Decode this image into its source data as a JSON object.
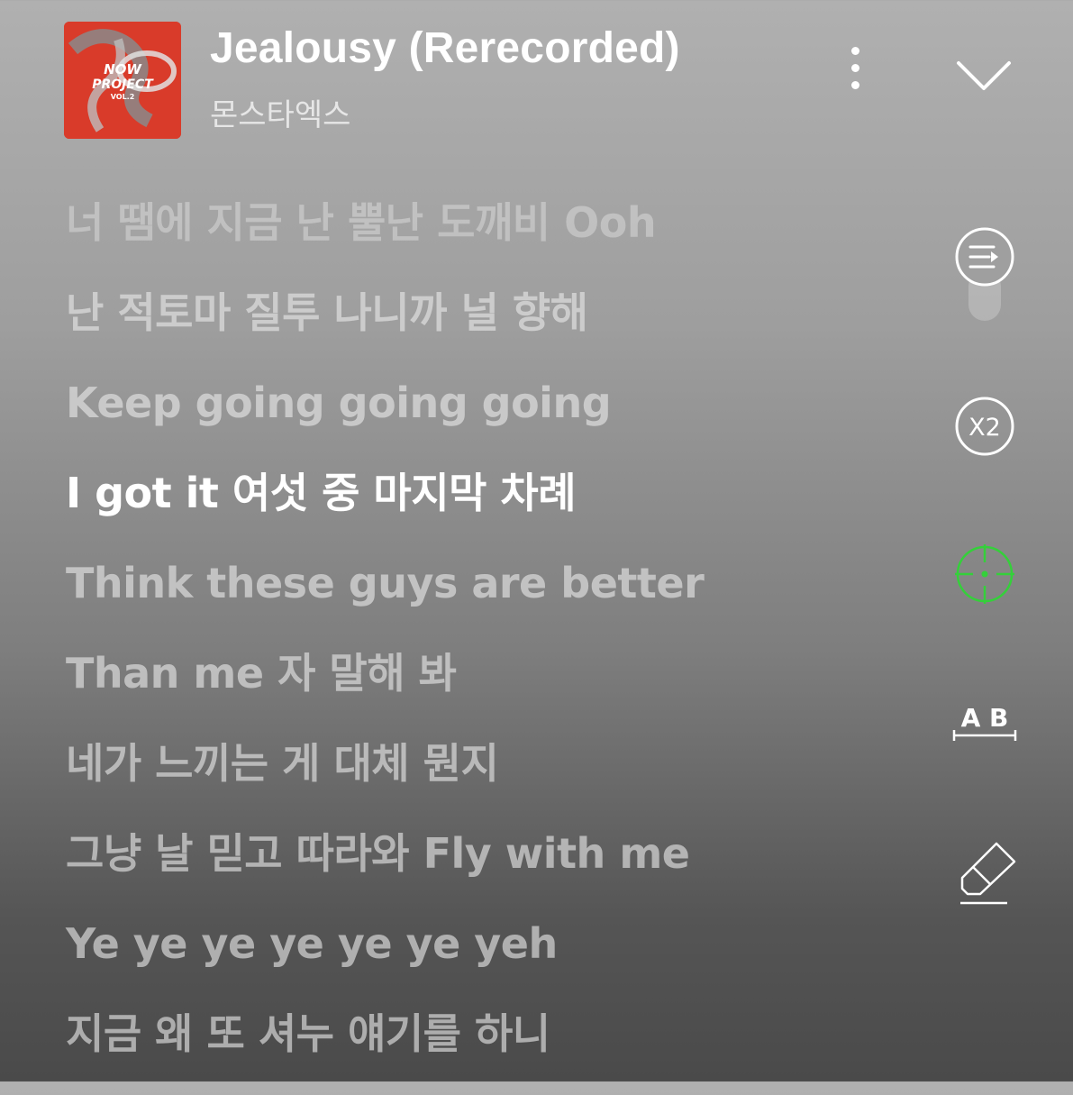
{
  "player": {
    "album_art_text": "NOW PROJECT VOL.2",
    "title": "Jealousy (Rerecorded)",
    "artist": "몬스타엑스"
  },
  "lyrics": [
    "너 땜에 지금 난 뿔난 도깨비 Ooh",
    "난 적토마 질투 나니까 널 향해",
    "Keep going going going",
    "I got it 여섯 중 마지막 차례",
    "Think these guys are better",
    "Than me 자 말해 봐",
    "네가 느끼는 게 대체 뭔지",
    "그냥 날 믿고 따라와 Fly with me",
    "Ye ye ye ye ye ye yeh",
    "지금 왜 또 셔누 얘기를 하니"
  ],
  "active_line_index": 3,
  "controls": {
    "speed_label": "X2",
    "translate_label": "A B",
    "icons": [
      "more-vertical-icon",
      "chevron-down-icon",
      "auto-scroll-icon",
      "speed-icon",
      "focus-crosshair-icon",
      "translate-icon",
      "highlighter-icon"
    ]
  },
  "colors": {
    "active_text": "#ffffff",
    "accent_green": "#34d03a",
    "album_red": "#d93b2a"
  }
}
